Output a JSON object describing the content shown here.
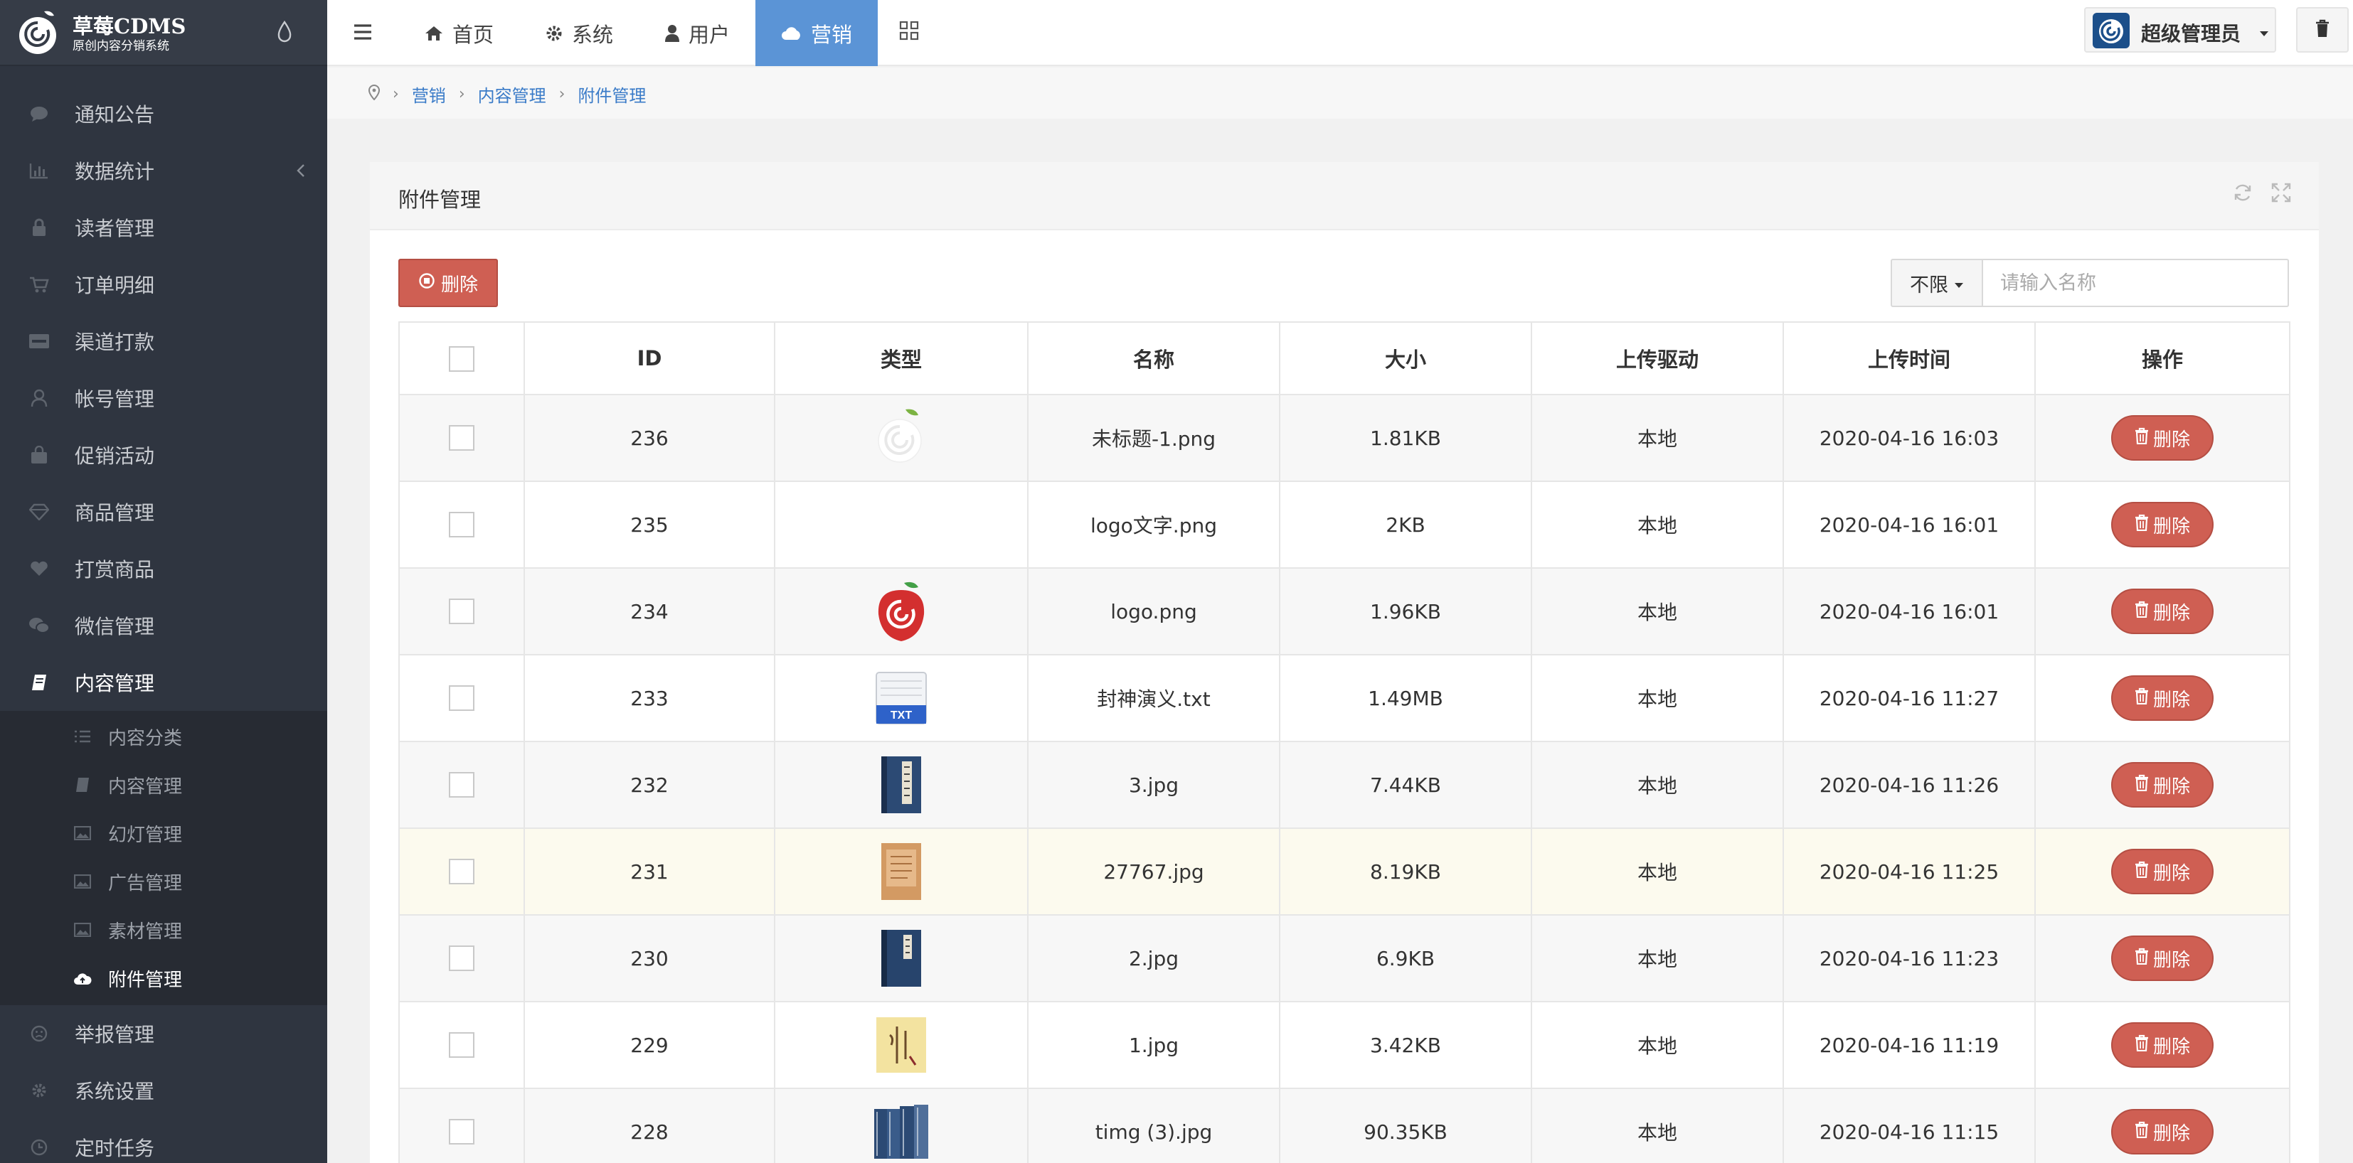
{
  "app": {
    "logo_title": "草莓CDMS",
    "logo_subtitle": "原创内容分销系统"
  },
  "sidebar": {
    "items": [
      {
        "label": "通知公告",
        "icon": "comment-icon"
      },
      {
        "label": "数据统计",
        "icon": "bar-chart-icon"
      },
      {
        "label": "读者管理",
        "icon": "lock-icon"
      },
      {
        "label": "订单明细",
        "icon": "cart-icon"
      },
      {
        "label": "渠道打款",
        "icon": "visa-card-icon"
      },
      {
        "label": "帐号管理",
        "icon": "user-icon"
      },
      {
        "label": "促销活动",
        "icon": "bag-icon"
      },
      {
        "label": "商品管理",
        "icon": "diamond-icon"
      },
      {
        "label": "打赏商品",
        "icon": "heart-icon"
      },
      {
        "label": "微信管理",
        "icon": "wechat-icon"
      },
      {
        "label": "内容管理",
        "icon": "book-icon"
      },
      {
        "label": "举报管理",
        "icon": "frown-icon"
      },
      {
        "label": "系统设置",
        "icon": "gear-icon"
      },
      {
        "label": "定时任务",
        "icon": "clock-icon"
      }
    ],
    "sub_items": [
      {
        "label": "内容分类",
        "icon": "list-icon"
      },
      {
        "label": "内容管理",
        "icon": "book-icon"
      },
      {
        "label": "幻灯管理",
        "icon": "image-icon"
      },
      {
        "label": "广告管理",
        "icon": "image-icon"
      },
      {
        "label": "素材管理",
        "icon": "image-icon"
      },
      {
        "label": "附件管理",
        "icon": "cloud-upload-icon"
      }
    ]
  },
  "topnav": {
    "items": [
      {
        "label": "首页",
        "icon": "home-icon"
      },
      {
        "label": "系统",
        "icon": "gear-icon"
      },
      {
        "label": "用户",
        "icon": "user-icon"
      },
      {
        "label": "营销",
        "icon": "cloud-icon"
      }
    ],
    "user_name": "超级管理员"
  },
  "breadcrumb": {
    "items": [
      "营销",
      "内容管理",
      "附件管理"
    ]
  },
  "panel": {
    "title": "附件管理",
    "delete_label": "删除",
    "filter_value": "不限",
    "search_placeholder": "请输入名称"
  },
  "table": {
    "headers": {
      "id": "ID",
      "type": "类型",
      "name": "名称",
      "size": "大小",
      "driver": "上传驱动",
      "time": "上传时间",
      "action": "操作"
    },
    "delete_label": "删除",
    "rows": [
      {
        "id": "236",
        "name": "未标题-1.png",
        "size": "1.81KB",
        "driver": "本地",
        "time": "2020-04-16 16:03",
        "thumb": "white-logo-thumbnail"
      },
      {
        "id": "235",
        "name": "logo文字.png",
        "size": "2KB",
        "driver": "本地",
        "time": "2020-04-16 16:01",
        "thumb": ""
      },
      {
        "id": "234",
        "name": "logo.png",
        "size": "1.96KB",
        "driver": "本地",
        "time": "2020-04-16 16:01",
        "thumb": "strawberry-logo-thumbnail"
      },
      {
        "id": "233",
        "name": "封神演义.txt",
        "size": "1.49MB",
        "driver": "本地",
        "time": "2020-04-16 11:27",
        "thumb": "txt-file-icon",
        "thumb_text": "TXT"
      },
      {
        "id": "232",
        "name": "3.jpg",
        "size": "7.44KB",
        "driver": "本地",
        "time": "2020-04-16 11:26",
        "thumb": "book-cover-thumbnail"
      },
      {
        "id": "231",
        "name": "27767.jpg",
        "size": "8.19KB",
        "driver": "本地",
        "time": "2020-04-16 11:25",
        "thumb": "book-cover-thumbnail"
      },
      {
        "id": "230",
        "name": "2.jpg",
        "size": "6.9KB",
        "driver": "本地",
        "time": "2020-04-16 11:23",
        "thumb": "book-cover-thumbnail"
      },
      {
        "id": "229",
        "name": "1.jpg",
        "size": "3.42KB",
        "driver": "本地",
        "time": "2020-04-16 11:19",
        "thumb": "book-cover-thumbnail"
      },
      {
        "id": "228",
        "name": "timg (3).jpg",
        "size": "90.35KB",
        "driver": "本地",
        "time": "2020-04-16 11:15",
        "thumb": "book-set-thumbnail"
      }
    ]
  },
  "colors": {
    "sidebar_bg": "#2f3540",
    "accent_blue": "#5b94d6",
    "danger_red": "#cf5f53",
    "link_blue": "#3a7bc8",
    "highlight_row": "#fcfaee"
  }
}
